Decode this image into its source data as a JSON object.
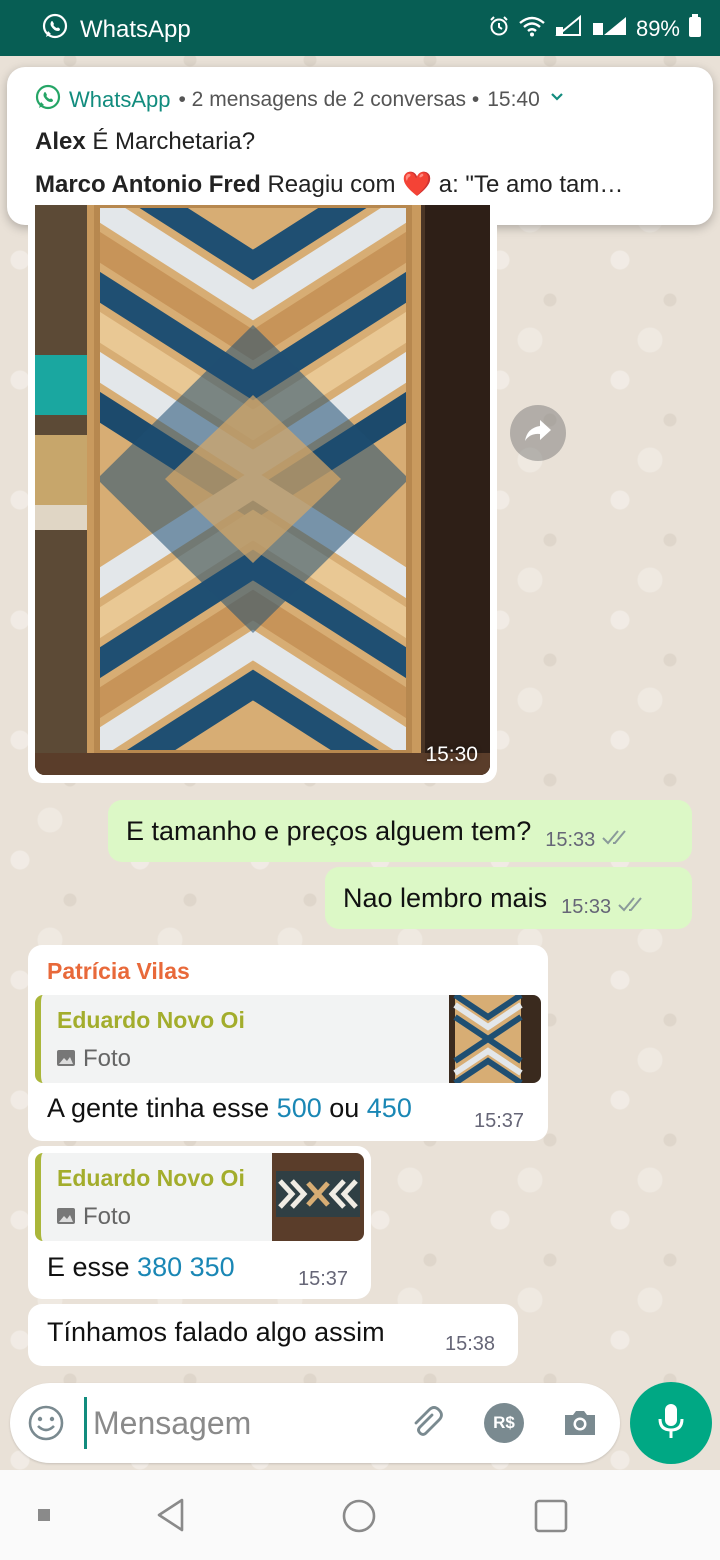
{
  "status_bar": {
    "app_name": "WhatsApp",
    "battery": "89%"
  },
  "notification": {
    "app_name": "WhatsApp",
    "summary": "• 2 mensagens de 2 conversas •",
    "time": "15:40",
    "lines": [
      {
        "sender": "Alex",
        "text": "É Marchetaria?"
      },
      {
        "sender": "Marco Antonio Fred",
        "text": "Reagiu com",
        "emoji": "❤️",
        "text_after": "a: \"Te amo tam…"
      }
    ]
  },
  "messages": {
    "image_message": {
      "time": "15:30"
    },
    "outgoing": [
      {
        "text": "E tamanho e preços alguem tem?",
        "time": "15:33"
      },
      {
        "text": "Nao lembro mais",
        "time": "15:33"
      }
    ],
    "incoming_1": {
      "sender": "Patrícia Vilas",
      "quote_name": "Eduardo Novo Oi",
      "quote_type": "Foto",
      "text_a": "A gente tinha esse ",
      "num_a": "500",
      "text_b": " ou ",
      "num_b": "450",
      "time": "15:37"
    },
    "incoming_2": {
      "quote_name": "Eduardo Novo Oi",
      "quote_type": "Foto",
      "text_a": "E esse ",
      "num_a": "380 350",
      "time": "15:37"
    },
    "incoming_3": {
      "text": "Tínhamos falado algo assim",
      "time": "15:38"
    }
  },
  "composer": {
    "placeholder": "Mensagem",
    "payment_label": "R$"
  },
  "colors": {
    "header_green": "#075e54",
    "outgoing_bubble": "#dcf8c6",
    "accent": "#00a884",
    "sender_orange": "#e8693a",
    "quote_olive": "#a3ad2c",
    "link_blue": "#1a87b5"
  }
}
